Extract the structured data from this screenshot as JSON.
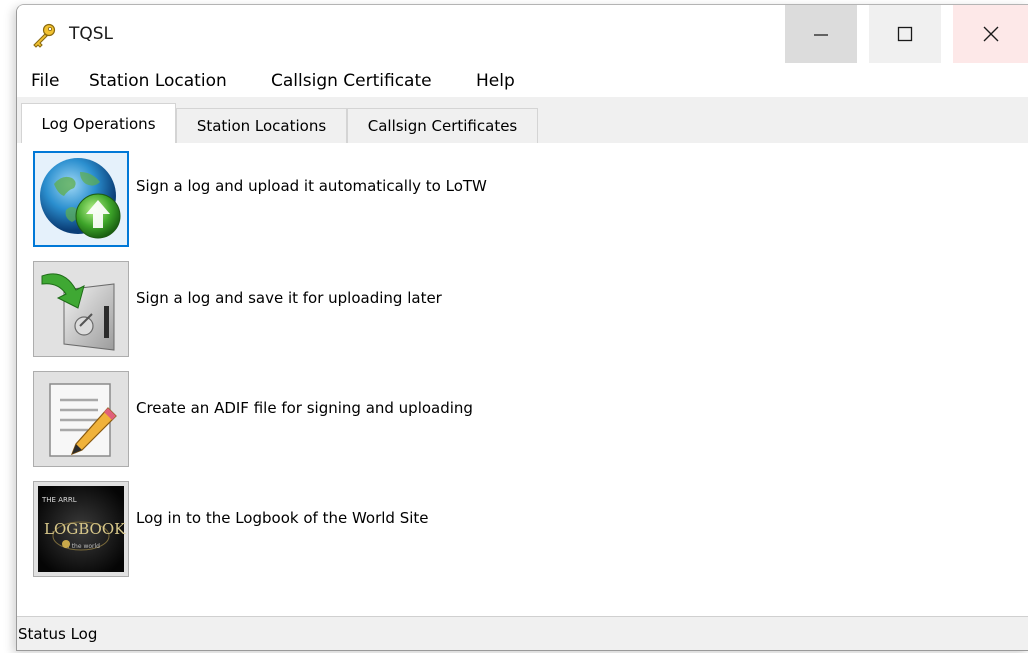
{
  "window": {
    "title": "TQSL",
    "controls": {
      "minimize_icon": "minimize-icon",
      "maximize_icon": "maximize-icon",
      "close_icon": "close-icon"
    }
  },
  "menubar": {
    "items": [
      {
        "label": "File"
      },
      {
        "label": "Station Location"
      },
      {
        "label": "Callsign Certificate"
      },
      {
        "label": "Help"
      }
    ]
  },
  "tabs": [
    {
      "label": "Log Operations",
      "active": true
    },
    {
      "label": "Station Locations",
      "active": false
    },
    {
      "label": "Callsign Certificates",
      "active": false
    }
  ],
  "actions": [
    {
      "label": "Sign a log and upload it automatically to LoTW",
      "icon": "globe-upload-icon"
    },
    {
      "label": "Sign a log and save it for uploading later",
      "icon": "save-disk-icon"
    },
    {
      "label": "Create an ADIF file for signing and uploading",
      "icon": "document-pencil-icon"
    },
    {
      "label": "Log in to the Logbook of the World Site",
      "icon": "logbook-icon"
    }
  ],
  "status": {
    "label": "Status Log"
  },
  "colors": {
    "accent": "#0078d7",
    "tab_background": "#f0f0f0",
    "button_face": "#e1e1e1"
  }
}
